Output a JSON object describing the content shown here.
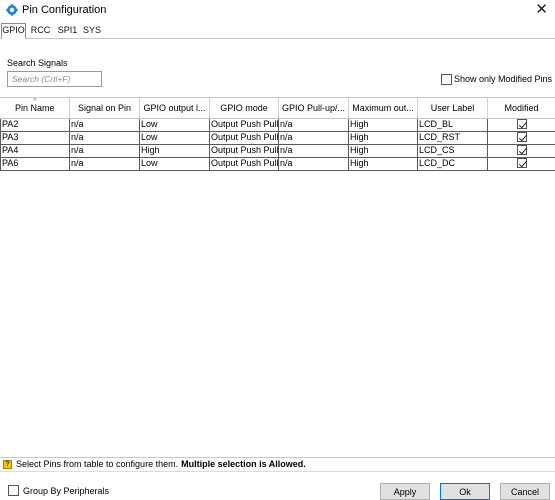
{
  "window": {
    "title": "Pin Configuration",
    "close_glyph": "✕"
  },
  "tabs": [
    {
      "label": "GPIO",
      "active": true
    },
    {
      "label": "RCC",
      "active": false
    },
    {
      "label": "SPI1",
      "active": false
    },
    {
      "label": "SYS",
      "active": false
    }
  ],
  "search": {
    "label": "Search Signals",
    "placeholder": "Search (Crtl+F)",
    "value": ""
  },
  "only_modified": {
    "label": "Show only Modified Pins",
    "checked": false
  },
  "table": {
    "sorted_column": "Pin Name",
    "columns": [
      "Pin Name",
      "Signal on Pin",
      "GPIO output l...",
      "GPIO mode",
      "GPIO Pull-up/...",
      "Maximum out...",
      "User Label",
      "Modified"
    ],
    "rows": [
      {
        "pin": "PA2",
        "signal": "n/a",
        "output_level": "Low",
        "mode": "Output Push Pull",
        "pull": "n/a",
        "max_speed": "High",
        "label": "LCD_BL",
        "modified": true
      },
      {
        "pin": "PA3",
        "signal": "n/a",
        "output_level": "Low",
        "mode": "Output Push Pull",
        "pull": "n/a",
        "max_speed": "High",
        "label": "LCD_RST",
        "modified": true
      },
      {
        "pin": "PA4",
        "signal": "n/a",
        "output_level": "High",
        "mode": "Output Push Pull",
        "pull": "n/a",
        "max_speed": "High",
        "label": "LCD_CS",
        "modified": true
      },
      {
        "pin": "PA6",
        "signal": "n/a",
        "output_level": "Low",
        "mode": "Output Push Pull",
        "pull": "n/a",
        "max_speed": "High",
        "label": "LCD_DC",
        "modified": true
      }
    ]
  },
  "status": {
    "icon": "hint-icon",
    "text": "Select Pins from table to configure them.",
    "bold_text": "Multiple selection is Allowed."
  },
  "footer": {
    "group_by": {
      "label": "Group By Peripherals",
      "checked": false
    },
    "apply_label": "Apply",
    "ok_label": "Ok",
    "cancel_label": "Cancel"
  },
  "colors": {
    "accent": "#0078d7",
    "hint": "#f3c600",
    "app_icon": "#1e88c8"
  }
}
